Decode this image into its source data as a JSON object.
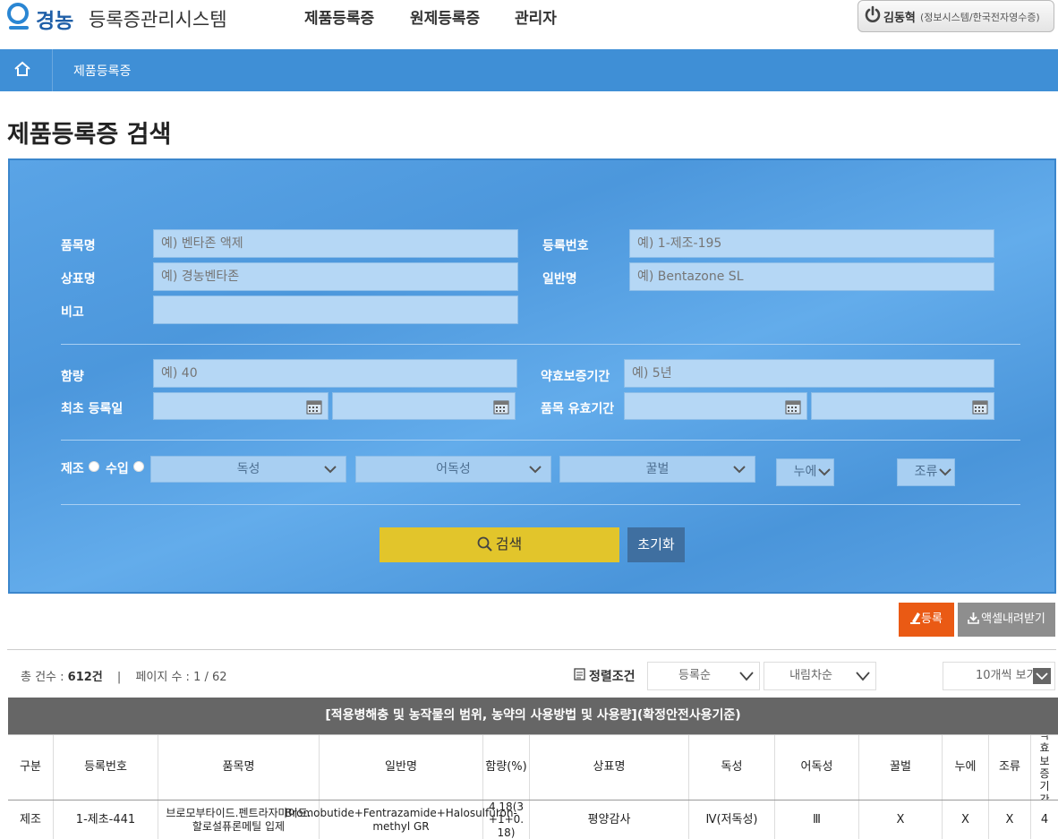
{
  "header": {
    "logo_text": "경농",
    "system_title": "등록증관리시스템",
    "nav": [
      "제품등록증",
      "원제등록증",
      "관리자"
    ],
    "user_name": "김동혁",
    "user_org": "(정보시스템/한국전자영수증)"
  },
  "breadcrumb": {
    "home_icon": "home-icon",
    "current": "제품등록증"
  },
  "page_title": "제품등록증 검색",
  "search": {
    "product_name": {
      "label": "품목명",
      "placeholder": "예) 벤타존 액제"
    },
    "reg_no": {
      "label": "등록번호",
      "placeholder": "예) 1-제조-195"
    },
    "brand_name": {
      "label": "상표명",
      "placeholder": "예) 경농벤타존"
    },
    "generic_name": {
      "label": "일반명",
      "placeholder": "예) Bentazone SL"
    },
    "remark": {
      "label": "비고",
      "placeholder": ""
    },
    "content": {
      "label": "함량",
      "placeholder": "예) 40"
    },
    "efficacy_period": {
      "label": "약효보증기간",
      "placeholder": "예) 5년"
    },
    "first_reg_date": {
      "label": "최초 등록일"
    },
    "validity_period": {
      "label": "품목 유효기간"
    },
    "radio": [
      "제조",
      "수입"
    ],
    "selects": [
      "독성",
      "어독성",
      "꿀벌",
      "누에",
      "조류"
    ],
    "search_button": "검색",
    "reset_button": "초기화"
  },
  "actions": {
    "register": "등록",
    "excel": "액셀내려받기"
  },
  "list_info": {
    "total_label": "총 건수 : ",
    "total": "612건",
    "sep": "|",
    "page_label": "페이지 수 : ",
    "page": "1 / 62",
    "sort_label": "정렬조건",
    "sort_field": "등록순",
    "sort_order": "내림차순",
    "page_size": "10개씩 보기"
  },
  "table": {
    "group_header": "[적용병해충 및 농작물의 범위, 농약의 사용방법 및 사용량](확정안전사용기준)",
    "columns": [
      "구분",
      "등록번호",
      "품목명",
      "일반명",
      "함량(%)",
      "상표명",
      "독성",
      "어독성",
      "꿀벌",
      "누에",
      "조류",
      "약효보증기간"
    ],
    "rows": [
      [
        "제조",
        "1-제초-441",
        "브로모부타이드.펜트라자마이드.할로설퓨론메틸 입제",
        "Bromobutide+Fentrazamide+Halosulfuron-methyl GR",
        "4.18(3+1+0.18)",
        "평양감사",
        "Ⅳ(저독성)",
        "Ⅲ",
        "X",
        "X",
        "X",
        "4"
      ]
    ]
  },
  "colors": {
    "accent_blue": "#3f8fd6",
    "search_yellow": "#e2c52b",
    "register_orange": "#ea5a14"
  }
}
